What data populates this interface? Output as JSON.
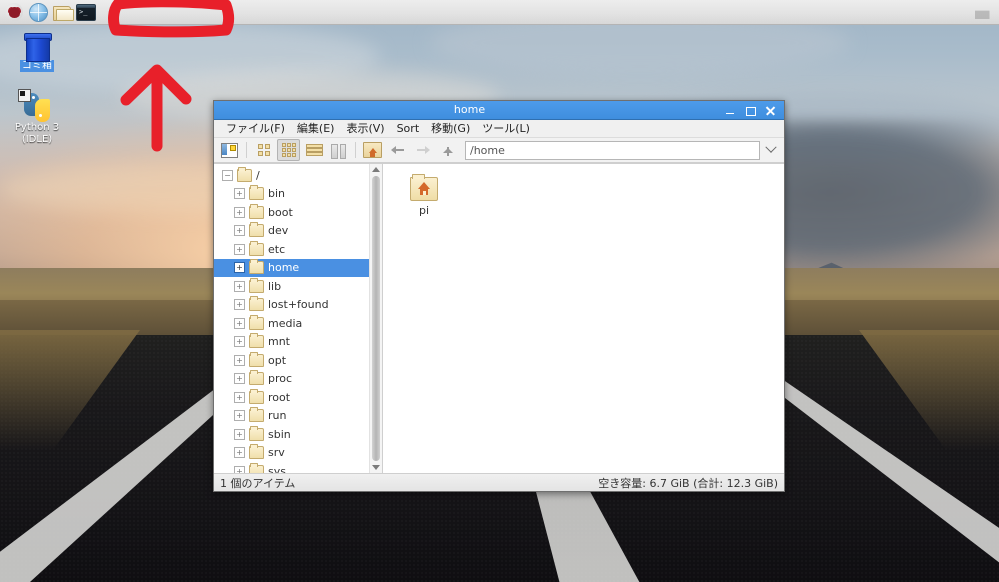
{
  "taskbar": {
    "items": [
      {
        "name": "raspberry-menu",
        "icon": "raspberry-icon",
        "label": "Menu"
      },
      {
        "name": "web-browser",
        "icon": "globe-icon",
        "label": "Web Browser"
      },
      {
        "name": "file-manager",
        "icon": "file-manager-icon",
        "label": "File Manager"
      },
      {
        "name": "terminal",
        "icon": "terminal-icon",
        "label": "Terminal"
      }
    ],
    "tray": [
      {
        "name": "eject-media",
        "icon": "eject-icon",
        "label": "Ejecter"
      }
    ]
  },
  "desktop": {
    "icons": [
      {
        "name": "trash",
        "label": "ゴミ箱",
        "selected": true
      },
      {
        "name": "python-idle",
        "label": "Python 3 (IDLE)",
        "selected": false
      }
    ]
  },
  "window": {
    "title": "home",
    "controls": {
      "minimize": "_",
      "maximize": "□",
      "close": "✕"
    },
    "menu": [
      {
        "name": "menu-file",
        "label": "ファイル(F)"
      },
      {
        "name": "menu-edit",
        "label": "編集(E)"
      },
      {
        "name": "menu-view",
        "label": "表示(V)"
      },
      {
        "name": "menu-sort",
        "label": "Sort"
      },
      {
        "name": "menu-go",
        "label": "移動(G)"
      },
      {
        "name": "menu-tools",
        "label": "ツール(L)"
      }
    ],
    "toolbar": {
      "buttons": [
        {
          "name": "toggle-sidebar-button",
          "icon": "sidebar-icon",
          "active": false
        },
        {
          "name": "icon-view-button",
          "icon": "grid-2x2-icon",
          "active": false
        },
        {
          "name": "thumbnail-view-button",
          "icon": "grid-3x3-icon",
          "active": true
        },
        {
          "name": "compact-view-button",
          "icon": "compact-list-icon",
          "active": false
        },
        {
          "name": "detailed-view-button",
          "icon": "columns-icon",
          "active": false
        },
        {
          "name": "home-button",
          "icon": "home-folder-icon",
          "active": false
        },
        {
          "name": "back-button",
          "icon": "arrow-left-icon",
          "active": false
        },
        {
          "name": "forward-button",
          "icon": "arrow-right-icon",
          "active": false
        },
        {
          "name": "up-button",
          "icon": "arrow-up-icon",
          "active": false
        }
      ],
      "path_value": "/home",
      "path_placeholder": "/home"
    },
    "tree": {
      "root": {
        "label": "/",
        "expander": "−",
        "selected": false
      },
      "items": [
        {
          "label": "bin",
          "expander": "+",
          "selected": false
        },
        {
          "label": "boot",
          "expander": "+",
          "selected": false
        },
        {
          "label": "dev",
          "expander": "+",
          "selected": false
        },
        {
          "label": "etc",
          "expander": "+",
          "selected": false
        },
        {
          "label": "home",
          "expander": "+",
          "selected": true
        },
        {
          "label": "lib",
          "expander": "+",
          "selected": false
        },
        {
          "label": "lost+found",
          "expander": "+",
          "selected": false
        },
        {
          "label": "media",
          "expander": "+",
          "selected": false
        },
        {
          "label": "mnt",
          "expander": "+",
          "selected": false
        },
        {
          "label": "opt",
          "expander": "+",
          "selected": false
        },
        {
          "label": "proc",
          "expander": "+",
          "selected": false
        },
        {
          "label": "root",
          "expander": "+",
          "selected": false
        },
        {
          "label": "run",
          "expander": "+",
          "selected": false
        },
        {
          "label": "sbin",
          "expander": "+",
          "selected": false
        },
        {
          "label": "srv",
          "expander": "+",
          "selected": false
        },
        {
          "label": "sys",
          "expander": "+",
          "selected": false
        }
      ]
    },
    "files": [
      {
        "name": "folder-pi",
        "label": "pi",
        "icon": "home-folder-icon"
      }
    ],
    "statusbar": {
      "left": "1 個のアイテム",
      "right": "空き容量: 6.7 GiB (合計: 12.3 GiB)"
    }
  },
  "annotation": {
    "color": "#e8202a",
    "shapes": [
      "highlight-rectangle",
      "up-arrow"
    ]
  }
}
